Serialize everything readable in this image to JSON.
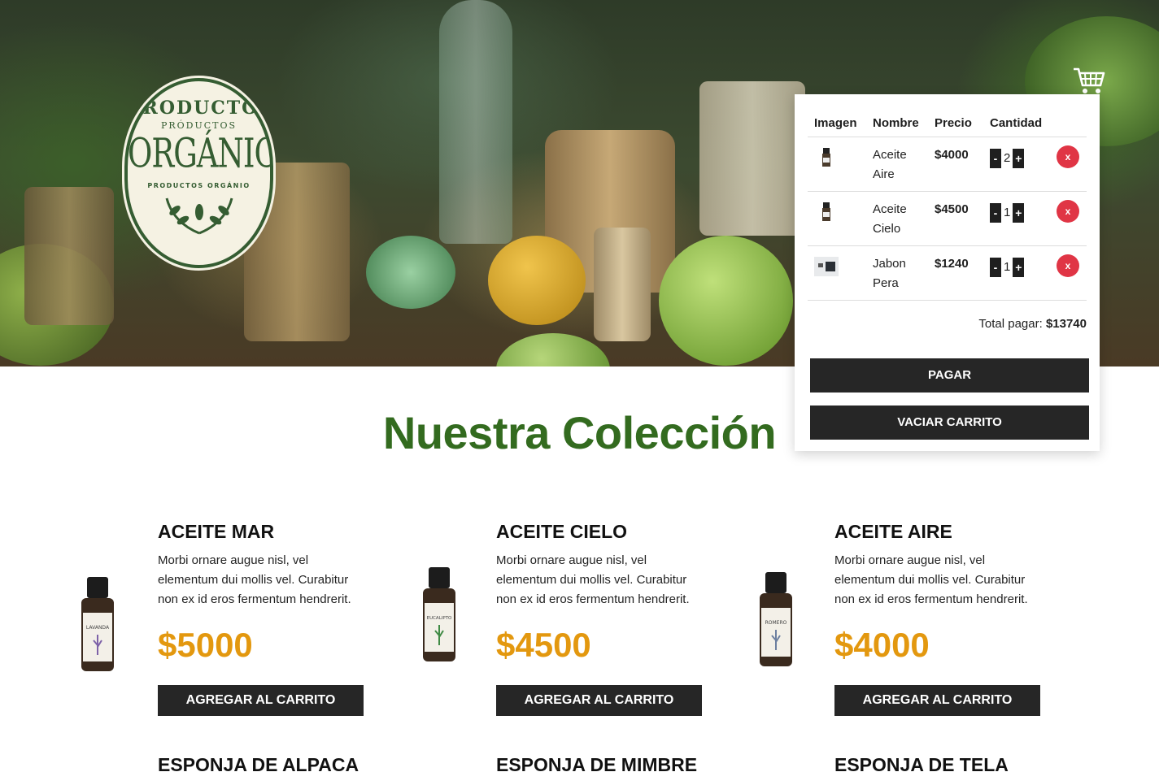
{
  "logo": {
    "top": "PRODUCTOS",
    "sub": "PRÓDUCTOS",
    "main": "ORGÁNICOS",
    "bottom": "PRODUCTOS ORGÁNIO"
  },
  "colors": {
    "brand_green": "#336b1f",
    "price_orange": "#e3980f",
    "button_dark": "#262626",
    "remove_red": "#e03545"
  },
  "cart": {
    "icon": "shopping-cart-icon",
    "headers": [
      "Imagen",
      "Nombre",
      "Precio",
      "Cantidad"
    ],
    "items": [
      {
        "name": "Aceite Aire",
        "price": "$4000",
        "qty": "2",
        "remove": "x",
        "minus": "-",
        "plus": "+"
      },
      {
        "name": "Aceite Cielo",
        "price": "$4500",
        "qty": "1",
        "remove": "x",
        "minus": "-",
        "plus": "+"
      },
      {
        "name": "Jabon Pera",
        "price": "$1240",
        "qty": "1",
        "remove": "x",
        "minus": "-",
        "plus": "+"
      }
    ],
    "total_label": "Total pagar:",
    "total_value": "$13740",
    "pay_label": "PAGAR",
    "empty_label": "VACIAR CARRITO"
  },
  "collection": {
    "title": "Nuestra Colección",
    "products": [
      {
        "name": "ACEITE MAR",
        "desc": "Morbi ornare augue nisl, vel elementum dui mollis vel. Curabitur non ex id eros fermentum hendrerit.",
        "price": "$5000",
        "button": "AGREGAR AL CARRITO",
        "label": "LAVANDA"
      },
      {
        "name": "ACEITE CIELO",
        "desc": "Morbi ornare augue nisl, vel elementum dui mollis vel. Curabitur non ex id eros fermentum hendrerit.",
        "price": "$4500",
        "button": "AGREGAR AL CARRITO",
        "label": "EUCALIPTO"
      },
      {
        "name": "ACEITE AIRE",
        "desc": "Morbi ornare augue nisl, vel elementum dui mollis vel. Curabitur non ex id eros fermentum hendrerit.",
        "price": "$4000",
        "button": "AGREGAR AL CARRITO",
        "label": "ROMERO"
      }
    ],
    "next_row": [
      "ESPONJA DE ALPACA",
      "ESPONJA DE MIMBRE",
      "ESPONJA DE TELA"
    ]
  }
}
